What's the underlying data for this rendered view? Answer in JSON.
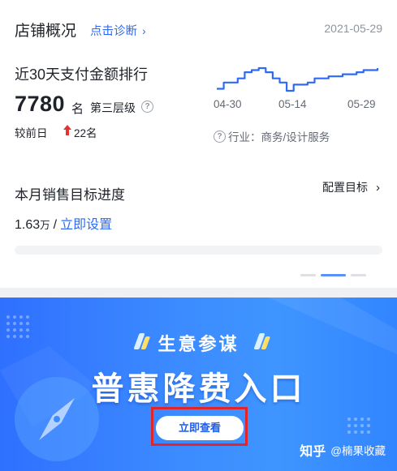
{
  "header": {
    "title": "店铺概况",
    "diagnose_link": "点击诊断",
    "date": "2021-05-29"
  },
  "ranking": {
    "title": "近30天支付金额排行",
    "rank": "7780",
    "rank_unit": "名",
    "tier": "第三层级",
    "compare_label": "较前日",
    "compare_change": "22名",
    "compare_direction": "up",
    "industry_label": "行业：商务/设计服务"
  },
  "trend_chart": {
    "x_labels": [
      "04-30",
      "05-14",
      "05-29"
    ],
    "series": [
      {
        "values": [
          6,
          9,
          9,
          11,
          14,
          15,
          16,
          14,
          11,
          9,
          5,
          8,
          8,
          9,
          11,
          11,
          12,
          12,
          13,
          13,
          14,
          15,
          15,
          16
        ]
      }
    ],
    "line_color": "#2f6bf2"
  },
  "goal": {
    "title": "本月销售目标进度",
    "config_label": "配置目标",
    "amount": "1.63",
    "amount_unit": "万",
    "separator": "/",
    "set_link": "立即设置",
    "progress_fraction": 0.0
  },
  "carousel": {
    "count": 3,
    "active_index": 1
  },
  "banner": {
    "title": "生意参谋",
    "main_text": "普惠降费入口",
    "button_label": "立即查看"
  },
  "watermark": {
    "platform": "知乎",
    "author": "@楠果收藏"
  },
  "colors": {
    "accent": "#2f6bf2",
    "up_arrow": "#e3322f",
    "banner_start": "#2f70ff",
    "banner_end": "#3f95ff",
    "highlight": "#e0262b"
  }
}
